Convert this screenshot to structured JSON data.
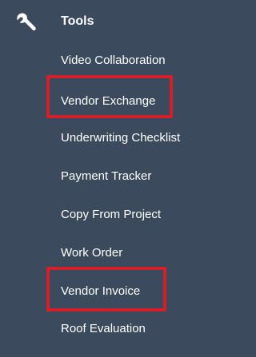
{
  "sidebar": {
    "section": {
      "title": "Tools",
      "icon": "wrench-icon"
    },
    "items": [
      {
        "label": "Video Collaboration"
      },
      {
        "label": "Vendor Exchange",
        "highlighted": true
      },
      {
        "label": "Underwriting Checklist"
      },
      {
        "label": "Payment Tracker"
      },
      {
        "label": "Copy From Project"
      },
      {
        "label": "Work Order"
      },
      {
        "label": "Vendor Invoice",
        "highlighted": true
      },
      {
        "label": "Roof Evaluation"
      }
    ]
  },
  "colors": {
    "background": "#3b4a5c",
    "text": "#ffffff",
    "highlight_border": "#d51f2b"
  }
}
